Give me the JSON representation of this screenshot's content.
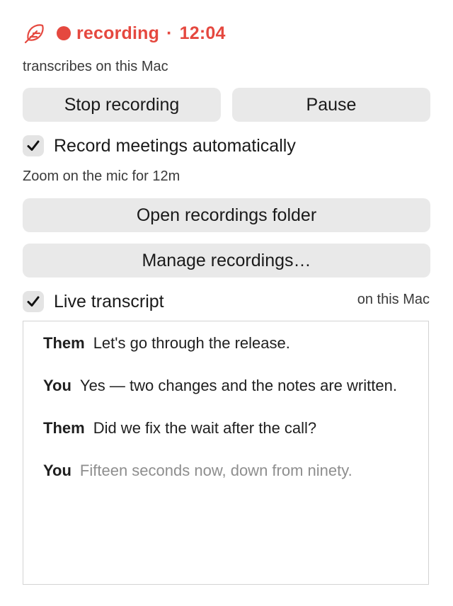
{
  "header": {
    "icon": "feather-icon",
    "status_word": "recording",
    "separator": "·",
    "elapsed": "12:04",
    "accent_color": "#e5483f"
  },
  "subtitle": "transcribes on this Mac",
  "buttons": {
    "stop": "Stop recording",
    "pause": "Pause",
    "open_folder": "Open recordings folder",
    "manage": "Manage recordings…"
  },
  "auto_record": {
    "label": "Record meetings automatically",
    "checked": true
  },
  "mic_note": "Zoom on the mic for 12m",
  "live_transcript": {
    "label": "Live transcript",
    "checked": true,
    "location": "on this Mac"
  },
  "transcript": [
    {
      "speaker": "Them",
      "text": "Let's go through the release.",
      "pending": false
    },
    {
      "speaker": "You",
      "text": "Yes — two changes and the notes are written.",
      "pending": false
    },
    {
      "speaker": "Them",
      "text": "Did we fix the wait after the call?",
      "pending": false
    },
    {
      "speaker": "You",
      "text": "Fifteen seconds now, down from ninety.",
      "pending": true
    }
  ]
}
